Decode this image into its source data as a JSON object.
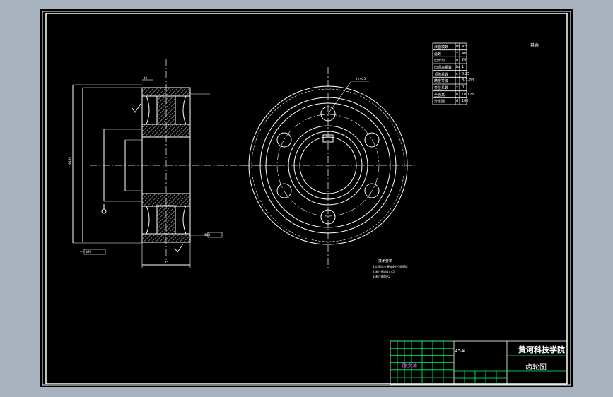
{
  "title_block": {
    "school": "黄河科技学院",
    "drawing_name": "齿轮图",
    "scale_label": "45#",
    "designer_label": "陈文涛"
  },
  "corner_note": "其余",
  "tech_notes": {
    "title": "技术要求",
    "items": [
      "1.齿面淬火硬度40~50HRC",
      "2.未注倒角1×45°",
      "3.未注圆角R2"
    ]
  },
  "param_table": [
    {
      "name": "法面模数",
      "sym": "m",
      "val": "4.5"
    },
    {
      "name": "齿数",
      "sym": "z",
      "val": "40"
    },
    {
      "name": "齿形角",
      "sym": "α",
      "val": "20°"
    },
    {
      "name": "齿顶高系数",
      "sym": "ha",
      "val": "1"
    },
    {
      "name": "顶隙系数",
      "sym": "c",
      "val": "0.25"
    },
    {
      "name": "精度等级",
      "sym": "",
      "val": "8-7-7FL"
    },
    {
      "name": "变位系数",
      "sym": "x",
      "val": "0"
    },
    {
      "name": "全齿高",
      "sym": "h",
      "val": "10.125"
    },
    {
      "name": "分度圆",
      "sym": "d",
      "val": "180"
    }
  ],
  "dimensions": {
    "outer_dia": "Φ189",
    "bore_dia": "Φ50",
    "hub_dia": "Φ90",
    "width": "45",
    "rim_thk": "10",
    "hole_note": "4×Φ25"
  }
}
